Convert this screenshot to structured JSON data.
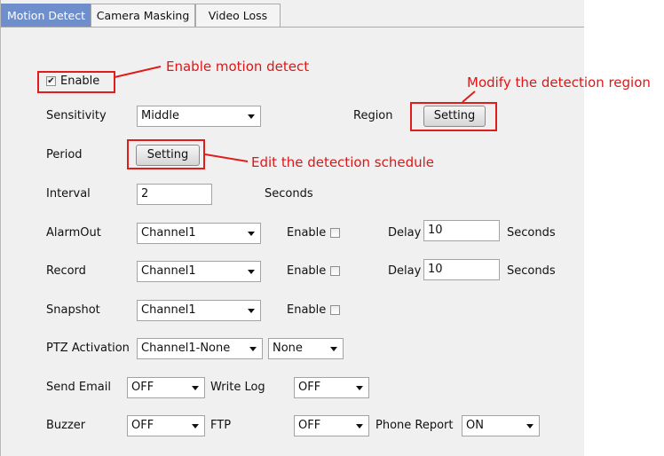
{
  "tabs": [
    "Motion Detect",
    "Camera Masking",
    "Video Loss"
  ],
  "enable_checkbox": {
    "label": "Enable",
    "checked": true
  },
  "sensitivity": {
    "label": "Sensitivity",
    "value": "Middle"
  },
  "region": {
    "label": "Region",
    "button": "Setting"
  },
  "period": {
    "label": "Period",
    "button": "Setting"
  },
  "interval": {
    "label": "Interval",
    "value": "2",
    "unit": "Seconds"
  },
  "alarmout": {
    "label": "AlarmOut",
    "channel": "Channel1",
    "enable_label": "Enable",
    "delay_label": "Delay",
    "delay": "10",
    "unit": "Seconds"
  },
  "record": {
    "label": "Record",
    "channel": "Channel1",
    "enable_label": "Enable",
    "delay_label": "Delay",
    "delay": "10",
    "unit": "Seconds"
  },
  "snapshot": {
    "label": "Snapshot",
    "channel": "Channel1",
    "enable_label": "Enable"
  },
  "ptz": {
    "label": "PTZ Activation",
    "channel": "Channel1-None",
    "preset": "None"
  },
  "send_email": {
    "label": "Send Email",
    "value": "OFF"
  },
  "write_log": {
    "label": "Write Log",
    "value": "OFF"
  },
  "buzzer": {
    "label": "Buzzer",
    "value": "OFF"
  },
  "ftp": {
    "label": "FTP",
    "value": "OFF"
  },
  "phone_report": {
    "label": "Phone Report",
    "value": "ON"
  },
  "annotations": {
    "enable": "Enable motion detect",
    "region": "Modify the detection region",
    "schedule": "Edit the detection schedule"
  },
  "colors": {
    "annotation": "#e21b1b",
    "active_tab": "#6e8fcb",
    "panel": "#f0f0f0"
  },
  "icons": {
    "dropdown": "chevron-down-icon",
    "check": "checkmark-icon"
  }
}
